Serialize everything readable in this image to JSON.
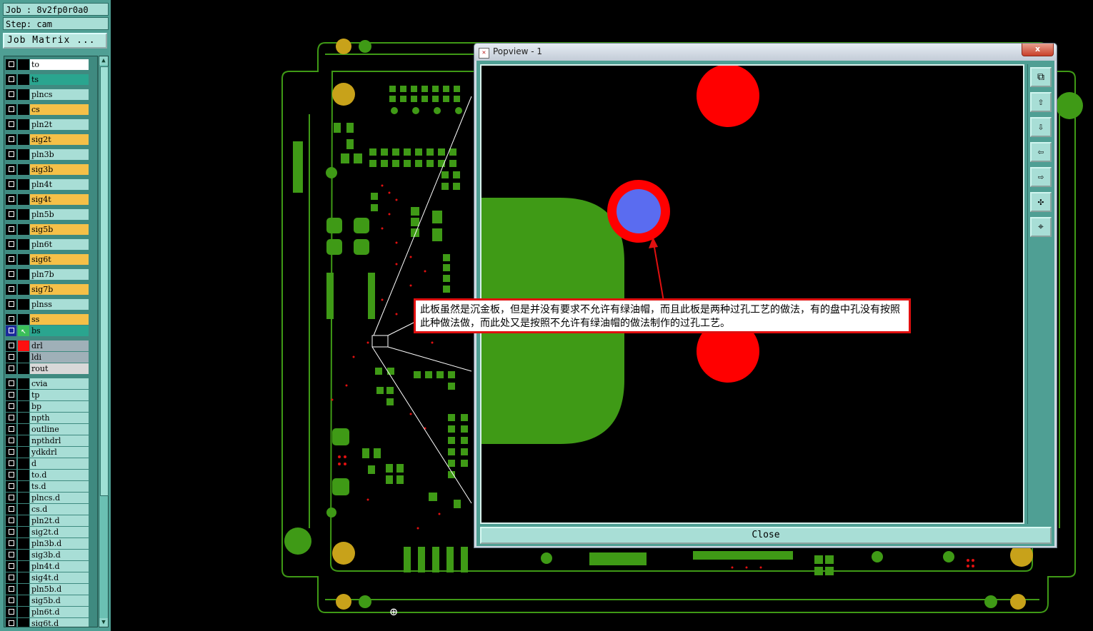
{
  "header": {
    "job_label": "Job : 8v2fp0r0a0",
    "step_label": "Step: cam",
    "job_matrix_button": "Job Matrix ..."
  },
  "layers": [
    {
      "name": "to",
      "color": "#ffffff"
    },
    {
      "name": "ts",
      "color": "#2aa58f"
    },
    {
      "name": "plncs",
      "color": "#a8ded6"
    },
    {
      "name": "cs",
      "color": "#f5c048"
    },
    {
      "name": "pln2t",
      "color": "#a8ded6"
    },
    {
      "name": "sig2t",
      "color": "#f5c048"
    },
    {
      "name": "pln3b",
      "color": "#a8ded6"
    },
    {
      "name": "sig3b",
      "color": "#f5c048"
    },
    {
      "name": "pln4t",
      "color": "#a8ded6"
    },
    {
      "name": "sig4t",
      "color": "#f5c048"
    },
    {
      "name": "pln5b",
      "color": "#a8ded6"
    },
    {
      "name": "sig5b",
      "color": "#f5c048"
    },
    {
      "name": "pln6t",
      "color": "#a8ded6"
    },
    {
      "name": "sig6t",
      "color": "#f5c048"
    },
    {
      "name": "pln7b",
      "color": "#a8ded6"
    },
    {
      "name": "sig7b",
      "color": "#f5c048"
    },
    {
      "name": "plnss",
      "color": "#a8ded6"
    },
    {
      "name": "ss",
      "color": "#f5c048"
    },
    {
      "name": "bs",
      "color": "#2aa58f",
      "active": true
    },
    {
      "name": "drl",
      "color": "#9fb0b8",
      "marker": "red"
    },
    {
      "name": "ldi",
      "color": "#9fb0b8"
    },
    {
      "name": "rout",
      "color": "#d8d8d8"
    },
    {
      "name": "cvia",
      "color": "#a8ded6"
    },
    {
      "name": "tp",
      "color": "#a8ded6"
    },
    {
      "name": "bp",
      "color": "#a8ded6"
    },
    {
      "name": "npth",
      "color": "#a8ded6"
    },
    {
      "name": "outline",
      "color": "#a8ded6"
    },
    {
      "name": "npthdrl",
      "color": "#a8ded6"
    },
    {
      "name": "ydkdrl",
      "color": "#a8ded6"
    },
    {
      "name": "d",
      "color": "#a8ded6"
    },
    {
      "name": "to.d",
      "color": "#a8ded6"
    },
    {
      "name": "ts.d",
      "color": "#a8ded6"
    },
    {
      "name": "plncs.d",
      "color": "#a8ded6"
    },
    {
      "name": "cs.d",
      "color": "#a8ded6"
    },
    {
      "name": "pln2t.d",
      "color": "#a8ded6"
    },
    {
      "name": "sig2t.d",
      "color": "#a8ded6"
    },
    {
      "name": "pln3b.d",
      "color": "#a8ded6"
    },
    {
      "name": "sig3b.d",
      "color": "#a8ded6"
    },
    {
      "name": "pln4t.d",
      "color": "#a8ded6"
    },
    {
      "name": "sig4t.d",
      "color": "#a8ded6"
    },
    {
      "name": "pln5b.d",
      "color": "#a8ded6"
    },
    {
      "name": "sig5b.d",
      "color": "#a8ded6"
    },
    {
      "name": "pln6t.d",
      "color": "#a8ded6"
    },
    {
      "name": "sig6t.d",
      "color": "#a8ded6"
    }
  ],
  "popview": {
    "title": "Popview - 1",
    "close_x": "x",
    "close_button": "Close",
    "tools": [
      "zoom-window-icon",
      "pan-up-icon",
      "pan-down-icon",
      "pan-left-icon",
      "pan-right-icon",
      "zoom-fit-icon",
      "zoom-home-icon"
    ]
  },
  "annotation": {
    "text": "此板虽然是沉金板，但是并没有要求不允许有绿油帽，而且此板是两种过孔工艺的做法，有的盘中孔没有按照此种做法做，而此处又是按照不允许有绿油帽的做法制作的过孔工艺。"
  },
  "colors": {
    "panel": "#4f9f94",
    "board_green": "#3f9a16",
    "drill_red": "#ff0000",
    "via_blue": "#5a6cf0",
    "annotation_border": "#e01010"
  }
}
